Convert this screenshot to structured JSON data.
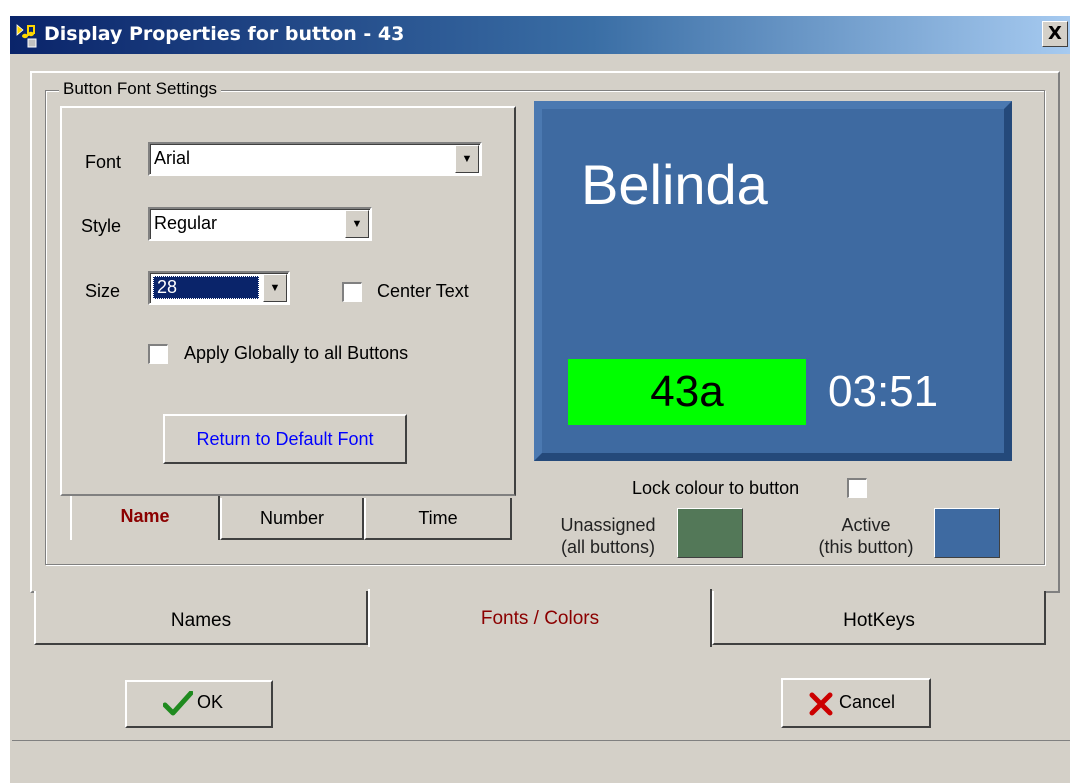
{
  "window": {
    "title": "Display Properties for button - 43",
    "close_glyph": "X"
  },
  "font_settings": {
    "group_title": "Button Font Settings",
    "font_label": "Font",
    "font_value": "Arial",
    "style_label": "Style",
    "style_value": "Regular",
    "size_label": "Size",
    "size_value": "28",
    "center_text_label": "Center Text",
    "center_text_checked": false,
    "apply_globally_label": "Apply Globally to all Buttons",
    "apply_globally_checked": false,
    "default_font_button": "Return to Default Font",
    "tabs": [
      "Name",
      "Number",
      "Time"
    ],
    "active_tab": "Name"
  },
  "preview": {
    "name": "Belinda",
    "number": "43a",
    "time": "03:51",
    "background_color": "#3e6aa1",
    "number_bg_color": "#00ff00"
  },
  "colors": {
    "lock_label": "Lock colour to button",
    "lock_checked": false,
    "unassigned_label_1": "Unassigned",
    "unassigned_label_2": "(all buttons)",
    "unassigned_color": "#537858",
    "active_label_1": "Active",
    "active_label_2": "(this button)",
    "active_color": "#3e6aa1"
  },
  "main_tabs": [
    "Names",
    "Fonts / Colors",
    "HotKeys"
  ],
  "active_main_tab": "Fonts / Colors",
  "buttons": {
    "ok": "OK",
    "cancel": "Cancel"
  },
  "icons": {
    "title": "music-note-app-icon",
    "ok": "checkmark-icon",
    "cancel": "red-x-icon",
    "dropdown": "chevron-down-icon"
  }
}
